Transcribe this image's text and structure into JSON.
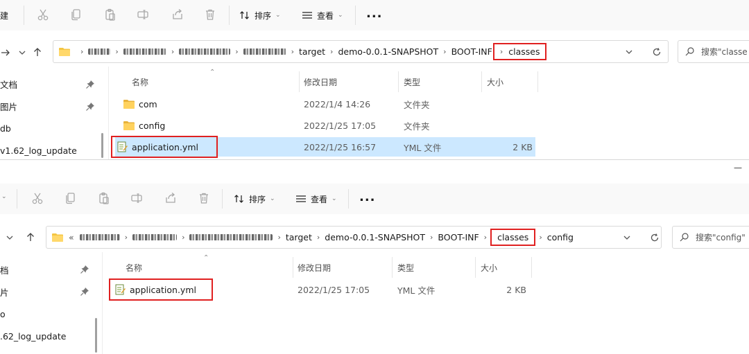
{
  "toolbar": {
    "new_label_partial": "建",
    "sort_label": "排序",
    "view_label": "查看",
    "more_label": "..."
  },
  "window1": {
    "address": {
      "crumbs": [
        "target",
        "demo-0.0.1-SNAPSHOT",
        "BOOT-INF",
        "classes"
      ]
    },
    "search_placeholder": "搜索\"classe",
    "sidebar": [
      "文档",
      "图片",
      "db",
      "v1.62_log_update"
    ],
    "columns": {
      "name": "名称",
      "date": "修改日期",
      "type": "类型",
      "size": "大小"
    },
    "rows": [
      {
        "name": "com",
        "date": "2022/1/4 14:26",
        "type": "文件夹",
        "size": "",
        "icon": "folder-icon"
      },
      {
        "name": "config",
        "date": "2022/1/25 17:05",
        "type": "文件夹",
        "size": "",
        "icon": "folder-icon"
      },
      {
        "name": "application.yml",
        "date": "2022/1/25 16:57",
        "type": "YML 文件",
        "size": "2 KB",
        "icon": "yml-file-icon"
      }
    ]
  },
  "window2": {
    "address": {
      "prefix": "«",
      "crumbs": [
        "target",
        "demo-0.0.1-SNAPSHOT",
        "BOOT-INF",
        "classes",
        "config"
      ]
    },
    "search_placeholder": "搜索\"config\"",
    "sidebar": [
      "档",
      "片",
      "o",
      ".62_log_update"
    ],
    "columns": {
      "name": "名称",
      "date": "修改日期",
      "type": "类型",
      "size": "大小"
    },
    "rows": [
      {
        "name": "application.yml",
        "date": "2022/1/25 17:05",
        "type": "YML 文件",
        "size": "2 KB",
        "icon": "yml-file-icon"
      }
    ]
  },
  "colors": {
    "highlight": "#e02020",
    "selected_row": "#cce8ff",
    "folder": "#f4c542"
  }
}
